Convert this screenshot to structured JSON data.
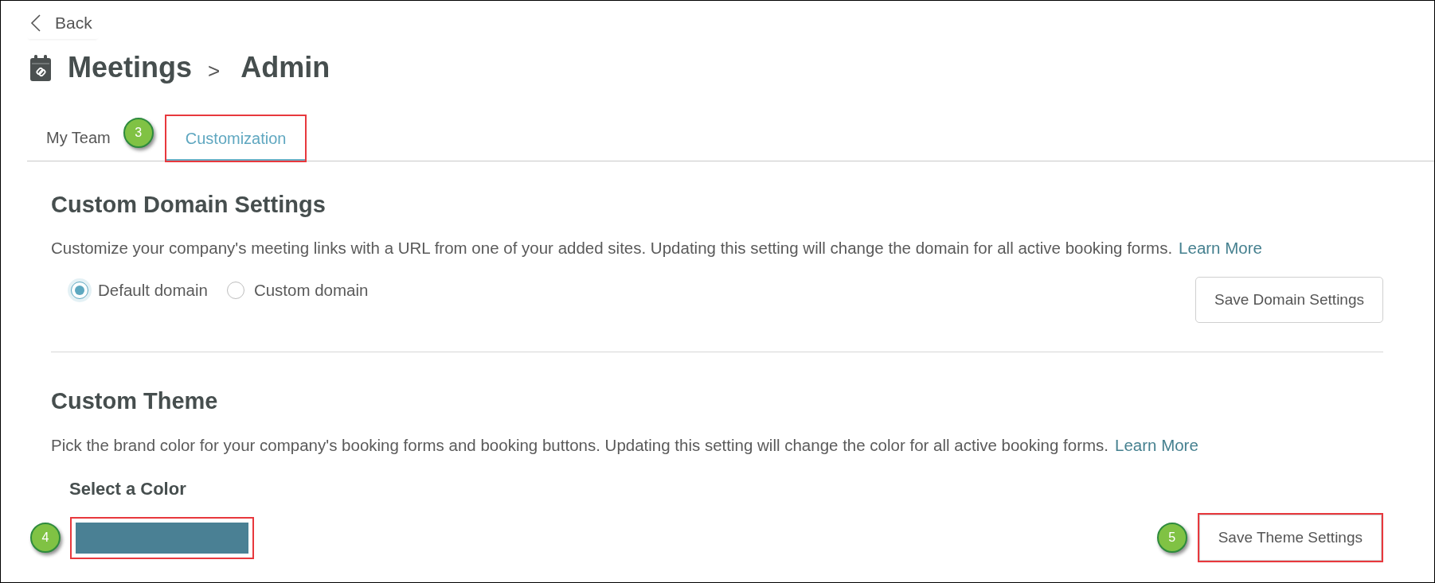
{
  "back": {
    "label": "Back"
  },
  "breadcrumb": {
    "items": [
      "Meetings",
      "Admin"
    ],
    "separator": ">"
  },
  "tabs": [
    {
      "label": "My Team",
      "selected": false,
      "highlighted": false
    },
    {
      "label": "Customization",
      "selected": true,
      "highlighted": true,
      "callout": "3"
    }
  ],
  "domain_section": {
    "title": "Custom Domain Settings",
    "description": "Customize your company's meeting links with a URL from one of your added sites. Updating this setting will change the domain for all active booking forms.",
    "link": "Learn More",
    "options": [
      {
        "label": "Default domain",
        "selected": true
      },
      {
        "label": "Custom domain",
        "selected": false
      }
    ],
    "save_button": {
      "label": "Save Domain Settings",
      "highlighted": false
    }
  },
  "theme_section": {
    "title": "Custom Theme",
    "description": "Pick the brand color for your company's booking forms and booking buttons. Updating this setting will change the color for all active booking forms.",
    "link": "Learn More",
    "color_picker": {
      "label": "Select a Color",
      "color": "#4a8094",
      "highlighted": true,
      "callout": "4"
    },
    "save_button": {
      "label": "Save Theme Settings",
      "highlighted": true,
      "callout": "5"
    }
  }
}
